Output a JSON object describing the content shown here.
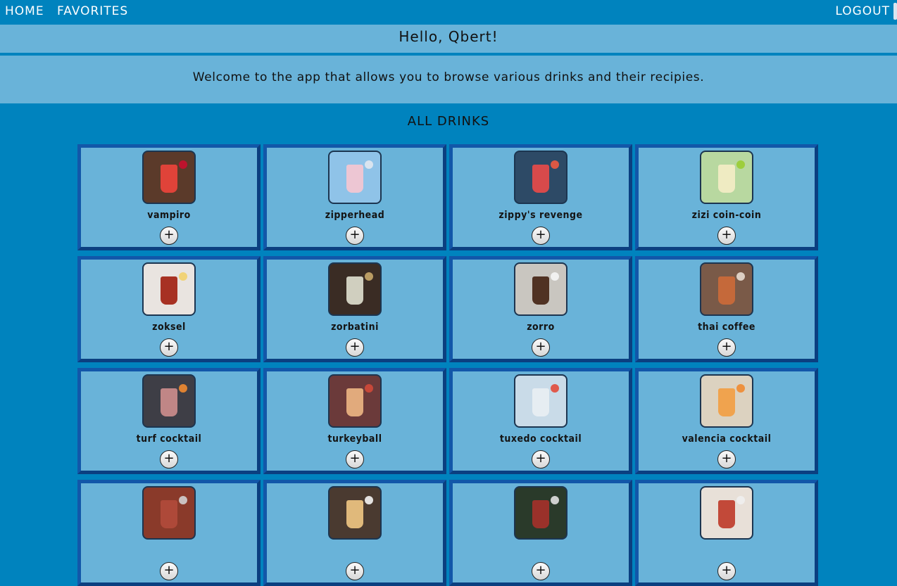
{
  "nav": {
    "home": "HOME",
    "favorites": "FAVORITES",
    "logout": "LOGOUT"
  },
  "greeting": "Hello, Qbert!",
  "welcome": "Welcome to the app that allows you to browse various drinks and their recipies.",
  "section_title": "ALL DRINKS",
  "add_symbol": "+",
  "colors": {
    "page_bg": "#0083be",
    "band_bg": "#69b3d9",
    "card_border": "#1257a9"
  },
  "drinks": [
    {
      "name": "vampiro",
      "bg": "#5b3a2a",
      "glass": "#e8433a",
      "garnish": "#c8102e"
    },
    {
      "name": "zipperhead",
      "bg": "#8fc3e8",
      "glass": "#f2c6d2",
      "garnish": "#e1e8f0"
    },
    {
      "name": "zippy's revenge",
      "bg": "#2d4a66",
      "glass": "#e24a4a",
      "garnish": "#f05a40"
    },
    {
      "name": "zizi coin-coin",
      "bg": "#b8d8a0",
      "glass": "#f1ecc4",
      "garnish": "#9acd32"
    },
    {
      "name": "zoksel",
      "bg": "#e9e4e0",
      "glass": "#a32718",
      "garnish": "#f2d06b"
    },
    {
      "name": "zorbatini",
      "bg": "#3a2c24",
      "glass": "#d8d8c8",
      "garnish": "#c9a86a"
    },
    {
      "name": "zorro",
      "bg": "#c9c6c0",
      "glass": "#4a2a1a",
      "garnish": "#f5f5f5"
    },
    {
      "name": "thai coffee",
      "bg": "#7a5a48",
      "glass": "#c96a3a",
      "garnish": "#e8dcd0"
    },
    {
      "name": "turf cocktail",
      "bg": "#3e3e46",
      "glass": "#c78a8a",
      "garnish": "#f08a30"
    },
    {
      "name": "turkeyball",
      "bg": "#6b3a3a",
      "glass": "#e8b080",
      "garnish": "#d14a3a"
    },
    {
      "name": "tuxedo cocktail",
      "bg": "#c9dbe8",
      "glass": "#e8eef2",
      "garnish": "#e24a3a"
    },
    {
      "name": "valencia cocktail",
      "bg": "#dcd2c0",
      "glass": "#f0a048",
      "garnish": "#f08a30"
    },
    {
      "name": "",
      "bg": "#8a3a2a",
      "glass": "#b04a3a",
      "garnish": "#d0d0d0"
    },
    {
      "name": "",
      "bg": "#4a3a30",
      "glass": "#e8c080",
      "garnish": "#f5f5f5"
    },
    {
      "name": "",
      "bg": "#2a3a2a",
      "glass": "#a0302a",
      "garnish": "#e0e0e0"
    },
    {
      "name": "",
      "bg": "#e8e0d8",
      "glass": "#c04030",
      "garnish": "#f0f0f0"
    }
  ]
}
